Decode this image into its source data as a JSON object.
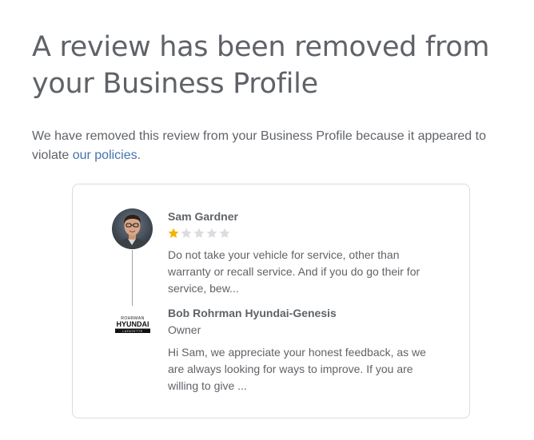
{
  "headline": "A review has been removed from your Business Profile",
  "intro": {
    "text_before": "We have removed this review from your Business Profile because it appeared to violate ",
    "link_text": "our policies",
    "text_after": "."
  },
  "review": {
    "reviewer_name": "Sam Gardner",
    "rating": 1,
    "rating_max": 5,
    "star_filled_color": "#f4b400",
    "star_empty_color": "#dadce0",
    "text": "Do not take your vehicle for service, other than warranty or recall service. And if you do go their for service, bew..."
  },
  "reply": {
    "owner_name": "Bob Rohrman Hyundai-Genesis",
    "owner_role": "Owner",
    "logo_text": {
      "top": "ROHRMAN",
      "main": "HYUNDAI",
      "bottom": "LAFAYETTE"
    },
    "text": "Hi Sam, we appreciate your honest feedback, as we are always looking for ways to improve. If you are willing to give ..."
  },
  "colors": {
    "text": "#5f6368",
    "link": "#4173b0",
    "card_border": "#dadce0"
  }
}
